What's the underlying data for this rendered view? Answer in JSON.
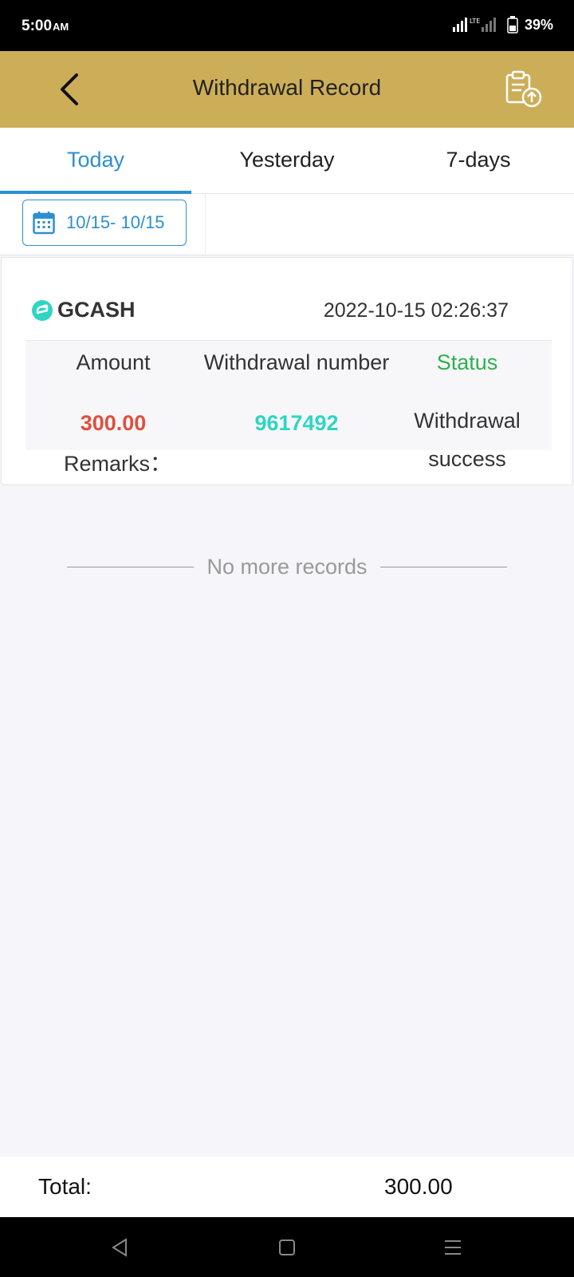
{
  "status_bar": {
    "time": "5:00",
    "ampm": "AM",
    "battery": "39%"
  },
  "header": {
    "title": "Withdrawal Record"
  },
  "tabs": [
    {
      "label": "Today",
      "active": true
    },
    {
      "label": "Yesterday",
      "active": false
    },
    {
      "label": "7-days",
      "active": false
    }
  ],
  "filter": {
    "date_range": "10/15- 10/15"
  },
  "record": {
    "provider": "GCASH",
    "datetime": "2022-10-15 02:26:37",
    "amount_label": "Amount",
    "number_label": "Withdrawal number",
    "status_label": "Status",
    "amount": "300.00",
    "number": "9617492",
    "status_line1": "Withdrawal",
    "status_line2": "success",
    "remarks_label": "Remarks："
  },
  "no_more": "No more records",
  "footer": {
    "total_label": "Total:",
    "total_value": "300.00"
  },
  "colors": {
    "header_bg": "#cdae58",
    "accent_blue": "#2d8fd0",
    "amount_red": "#e0503a",
    "number_teal": "#2fd5c2",
    "status_green": "#2bb24c"
  }
}
